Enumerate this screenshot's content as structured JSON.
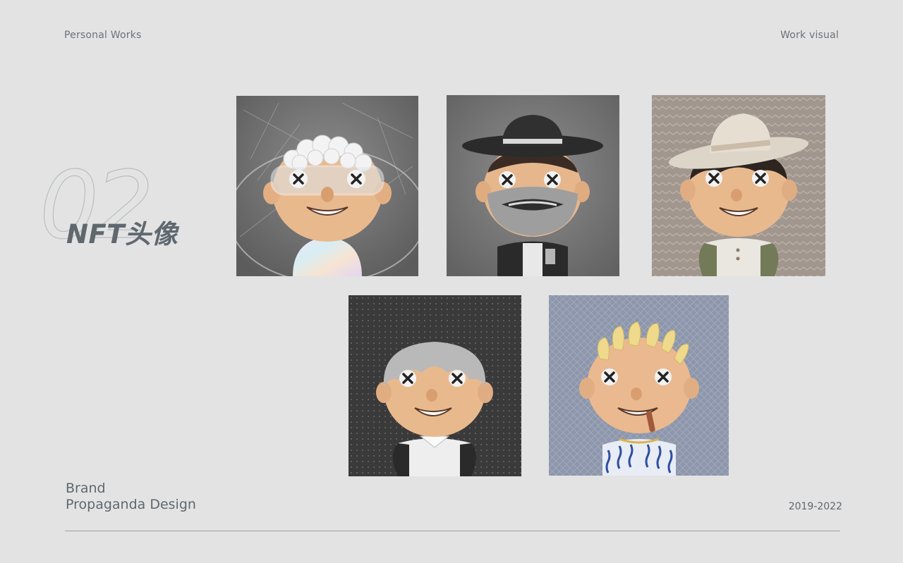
{
  "header": {
    "left_label": "Personal Works",
    "right_label": "Work visual"
  },
  "section": {
    "number": "02",
    "title": "NFT头像"
  },
  "gallery": {
    "avatars": [
      {
        "icon": "avatar-goggles-icon",
        "background": "#6f6f6f"
      },
      {
        "icon": "avatar-cowboy-mask-icon",
        "background": "#7a7a7a"
      },
      {
        "icon": "avatar-sunhat-icon",
        "background": "#a49a93"
      },
      {
        "icon": "avatar-grey-hair-icon",
        "background": "#3c3c3c"
      },
      {
        "icon": "avatar-blond-cigar-icon",
        "background": "#8a93a8"
      }
    ]
  },
  "footer": {
    "brand_line1": "Brand",
    "brand_line2": "Propaganda Design",
    "years": "2019-2022"
  },
  "colors": {
    "page_background": "#e3e3e3",
    "text": "#5f686e",
    "skin": "#e9b98e"
  }
}
